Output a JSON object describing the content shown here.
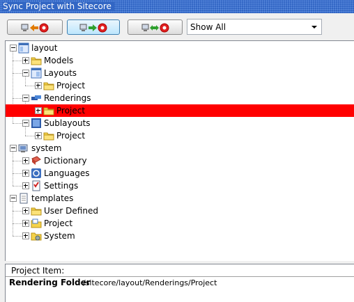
{
  "window": {
    "title": "Sync Project with Sitecore"
  },
  "toolbar": {
    "buttons": [
      {
        "name": "sync-from-sitecore",
        "icon": "computer-arrow-left-stop-icon",
        "arrow_color": "#e07a00"
      },
      {
        "name": "sync-to-sitecore",
        "icon": "computer-arrow-right-stop-icon",
        "arrow_color": "#2ea02e"
      },
      {
        "name": "sync-both-ways",
        "icon": "computer-arrow-both-stop-icon",
        "arrow_color": "#2ea02e"
      }
    ],
    "filter": {
      "selected": "Show All"
    }
  },
  "tree": [
    {
      "label": "layout",
      "depth": 0,
      "expanded": true,
      "icon": "layout-icon"
    },
    {
      "label": "Models",
      "depth": 1,
      "expanded": false,
      "icon": "folder-icon"
    },
    {
      "label": "Layouts",
      "depth": 1,
      "expanded": true,
      "icon": "layouts-icon"
    },
    {
      "label": "Project",
      "depth": 2,
      "expanded": false,
      "icon": "folder-icon"
    },
    {
      "label": "Renderings",
      "depth": 1,
      "expanded": true,
      "icon": "renderings-icon"
    },
    {
      "label": "Project",
      "depth": 2,
      "expanded": false,
      "icon": "folder-icon",
      "selected": true
    },
    {
      "label": "Sublayouts",
      "depth": 1,
      "expanded": true,
      "icon": "sublayouts-icon"
    },
    {
      "label": "Project",
      "depth": 2,
      "expanded": false,
      "icon": "folder-icon"
    },
    {
      "label": "system",
      "depth": 0,
      "expanded": true,
      "icon": "system-icon"
    },
    {
      "label": "Dictionary",
      "depth": 1,
      "expanded": false,
      "icon": "dictionary-icon"
    },
    {
      "label": "Languages",
      "depth": 1,
      "expanded": false,
      "icon": "languages-icon"
    },
    {
      "label": "Settings",
      "depth": 1,
      "expanded": false,
      "icon": "settings-icon"
    },
    {
      "label": "templates",
      "depth": 0,
      "expanded": true,
      "icon": "templates-icon"
    },
    {
      "label": "User Defined",
      "depth": 1,
      "expanded": false,
      "icon": "folder-icon"
    },
    {
      "label": "Project",
      "depth": 1,
      "expanded": false,
      "icon": "project-folder-icon"
    },
    {
      "label": "System",
      "depth": 1,
      "expanded": false,
      "icon": "system-folder-icon"
    }
  ],
  "details": {
    "caption": "Project Item:",
    "key": "Rendering Folder",
    "value": "/sitecore/layout/Renderings/Project"
  },
  "colors": {
    "selection": "#ff0000",
    "titlebar": "#3266c4"
  }
}
